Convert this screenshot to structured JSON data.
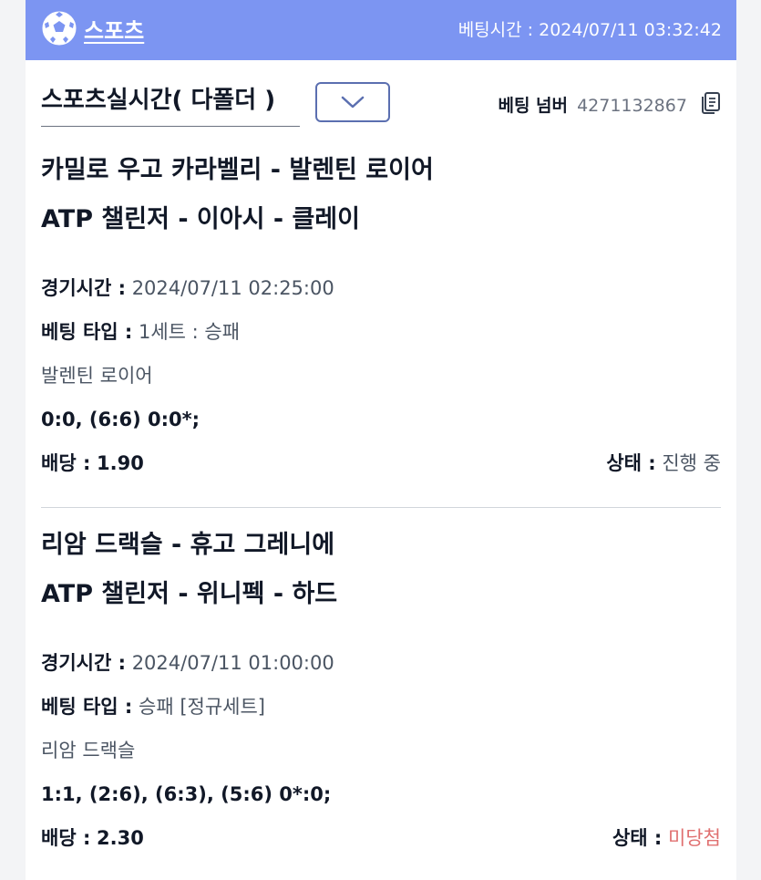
{
  "header": {
    "title": "스포츠",
    "bet_time": "베팅시간 : 2024/07/11 03:32:42"
  },
  "subbar": {
    "selected_type": "스포츠실시간( 다폴더 )",
    "bet_number_label": "베팅 넘버",
    "bet_number": "4271132867"
  },
  "matches": [
    {
      "teams": "카밀로 우고 카라벨리 - 발렌틴 로이어",
      "league": "ATP 챌린저 - 이아시 - 클레이",
      "game_time_label": "경기시간 :",
      "game_time": "2024/07/11 02:25:00",
      "bet_type_label": "베팅 타입 :",
      "bet_type": "1세트 : 승패",
      "pick": "발렌틴 로이어",
      "score": "0:0, (6:6) 0:0*;",
      "odds_label": "배당 :",
      "odds": "1.90",
      "status_label": "상태 :",
      "status": "진행 중",
      "status_color": "#4b5563"
    },
    {
      "teams": "리암 드랙슬 - 휴고 그레니에",
      "league": "ATP 챌린저 - 위니펙 - 하드",
      "game_time_label": "경기시간 :",
      "game_time": "2024/07/11 01:00:00",
      "bet_type_label": "베팅 타입 :",
      "bet_type": "승패 [정규세트]",
      "pick": "리암 드랙슬",
      "score": "1:1, (2:6), (6:3), (5:6) 0*:0;",
      "odds_label": "배당 :",
      "odds": "2.30",
      "status_label": "상태 :",
      "status": "미당첨",
      "status_color": "#e07070"
    }
  ]
}
